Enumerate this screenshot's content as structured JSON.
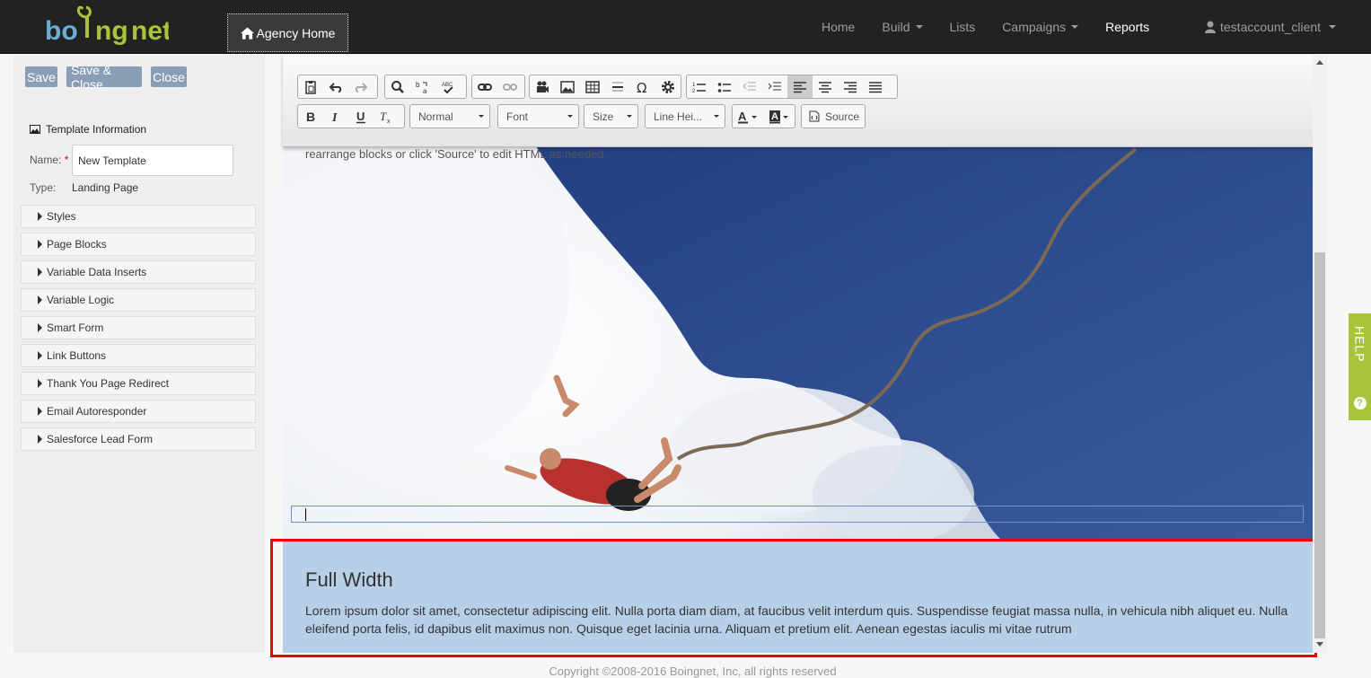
{
  "navbar": {
    "logo_text": "boingnet",
    "agency_home": "Agency Home",
    "items": [
      {
        "label": "Home",
        "dropdown": false,
        "active": false
      },
      {
        "label": "Build",
        "dropdown": true,
        "active": false
      },
      {
        "label": "Lists",
        "dropdown": false,
        "active": false
      },
      {
        "label": "Campaigns",
        "dropdown": true,
        "active": false
      },
      {
        "label": "Reports",
        "dropdown": false,
        "active": true
      }
    ],
    "user": "testaccount_client"
  },
  "sidebar": {
    "buttons": {
      "save": "Save",
      "save_close": "Save & Close",
      "close": "Close"
    },
    "template_info": "Template Information",
    "name_label": "Name:",
    "required_mark": "*",
    "name_value": "New Template",
    "type_label": "Type:",
    "type_value": "Landing Page",
    "sections": [
      "Styles",
      "Page Blocks",
      "Variable Data Inserts",
      "Variable Logic",
      "Smart Form",
      "Link Buttons",
      "Thank You Page Redirect",
      "Email Autoresponder",
      "Salesforce Lead Form"
    ]
  },
  "toolbar": {
    "format": "Normal",
    "font": "Font",
    "size": "Size",
    "line_height": "Line Hei...",
    "source": "Source",
    "icons": {
      "clipboard": "paste-icon",
      "undo": "undo-icon",
      "redo": "redo-icon",
      "find": "find-icon",
      "replace": "replace-icon",
      "spellcheck": "spellcheck-icon",
      "link": "link-icon",
      "unlink": "unlink-icon",
      "video": "video-icon",
      "image": "image-icon",
      "table": "table-icon",
      "hr": "horizontal-rule-icon",
      "omega": "special-char-icon",
      "gear": "gear-icon",
      "numbered": "numbered-list-icon",
      "bulleted": "bulleted-list-icon",
      "outdent": "outdent-icon",
      "indent": "indent-icon",
      "align_left": "align-left-icon",
      "align_center": "align-center-icon",
      "align_right": "align-right-icon",
      "justify": "justify-icon",
      "bold": "bold-icon",
      "italic": "italic-icon",
      "underline": "underline-icon",
      "clear_format": "clear-format-icon",
      "text_color": "text-color-icon",
      "bg_color": "background-color-icon"
    }
  },
  "editor": {
    "hidden_text": "rearrange blocks or click 'Source' to edit HTML as needed.",
    "fw_title": "Full Width",
    "fw_body": "Lorem ipsum dolor sit amet, consectetur adipiscing elit. Nulla porta diam diam, at faucibus velit interdum quis. Suspendisse feugiat massa nulla, in vehicula nibh aliquet eu. Nulla eleifend porta felis, id dapibus elit maximus non. Quisque eget lacinia urna. Aliquam et pretium elit. Aenean egestas iaculis mi vitae rutrum"
  },
  "footer": "Copyright ©2008-2016 Boingnet, Inc, all rights reserved",
  "help_tab": {
    "label": "HELP",
    "icon": "?"
  },
  "colors": {
    "navbar": "#222222",
    "sidebar_button": "#8a9fb5",
    "full_width_bg": "#b7d0e8",
    "highlight_box": "#ee0000",
    "help_tab": "#a8c43a",
    "sky": "#2a4a8a"
  }
}
